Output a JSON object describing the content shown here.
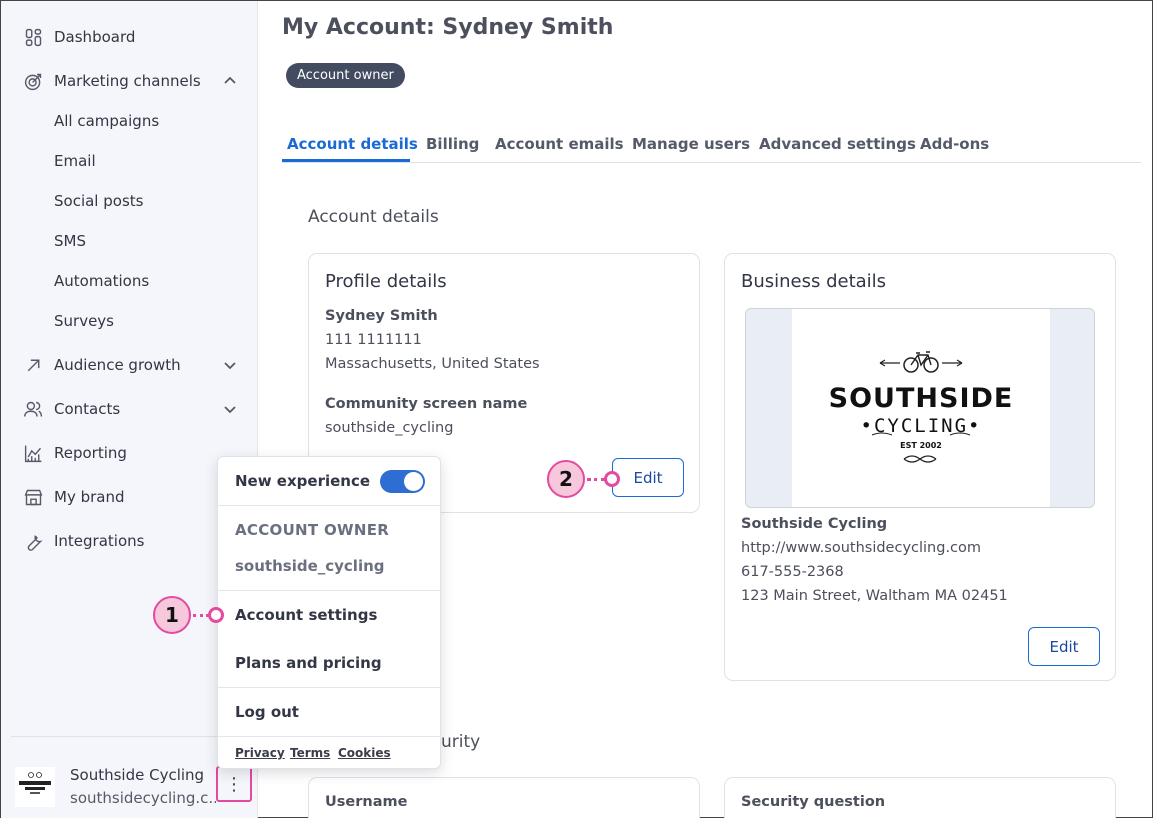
{
  "sidebar": {
    "items": [
      {
        "label": "Dashboard",
        "icon": "dashboard-icon"
      },
      {
        "label": "Marketing channels",
        "icon": "target-icon",
        "expanded": true
      },
      {
        "label": "Audience growth",
        "icon": "arrow-up-right-icon"
      },
      {
        "label": "Contacts",
        "icon": "contacts-icon"
      },
      {
        "label": "Reporting",
        "icon": "chart-icon"
      },
      {
        "label": "My brand",
        "icon": "store-icon"
      },
      {
        "label": "Integrations",
        "icon": "wrench-icon"
      }
    ],
    "subitems": [
      "All campaigns",
      "Email",
      "Social posts",
      "SMS",
      "Automations",
      "Surveys"
    ],
    "account": {
      "name": "Southside Cycling",
      "url": "southsidecycling.c..."
    }
  },
  "header": {
    "title": "My Account: Sydney Smith",
    "badge": "Account owner"
  },
  "tabs": [
    "Account details",
    "Billing",
    "Account emails",
    "Manage users",
    "Advanced settings",
    "Add-ons"
  ],
  "active_tab": "Account details",
  "main": {
    "section_title": "Account details",
    "profile": {
      "title": "Profile details",
      "name": "Sydney Smith",
      "phone": "111 1111111",
      "location": "Massachusetts, United States",
      "screen_name_label": "Community screen name",
      "screen_name": "southside_cycling",
      "edit_label": "Edit"
    },
    "business": {
      "title": "Business details",
      "logo_text": "SOUTHSIDE",
      "logo_subtext": "CYCLING",
      "logo_est": "EST 2002",
      "name": "Southside Cycling",
      "url": "http://www.southsidecycling.com",
      "phone": "617-555-2368",
      "address": "123 Main Street, Waltham MA 02451",
      "edit_label": "Edit"
    },
    "security_title_partial": "urity",
    "username_label": "Username",
    "security_question_label": "Security question"
  },
  "menu": {
    "new_experience": "New experience",
    "toggle_on": true,
    "owner_heading": "ACCOUNT OWNER",
    "owner_username": "southside_cycling",
    "account_settings": "Account settings",
    "plans": "Plans and pricing",
    "logout": "Log out",
    "footer": [
      "Privacy",
      "Terms",
      "Cookies"
    ]
  },
  "callouts": [
    "1",
    "2"
  ],
  "colors": {
    "accent": "#1a6ad6",
    "callout": "#e44aa0",
    "badge": "#424b5f"
  }
}
